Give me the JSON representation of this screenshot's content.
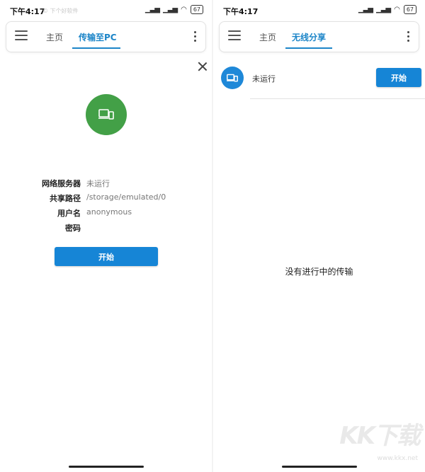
{
  "status_bar": {
    "time": "下午4:17",
    "left_watermark": "© 下个好软件",
    "signal_1": "▁▃▅",
    "signal_2": "▁▃▅",
    "wifi": "◠",
    "battery": "67"
  },
  "left_panel": {
    "tabs": [
      {
        "label": "主页",
        "active": false
      },
      {
        "label": "传输至PC",
        "active": true
      }
    ],
    "info": [
      {
        "label": "网络服务器",
        "value": "未运行"
      },
      {
        "label": "共享路径",
        "value": "/storage/emulated/0"
      },
      {
        "label": "用户名",
        "value": "anonymous"
      },
      {
        "label": "密码",
        "value": ""
      }
    ],
    "start_button": "开始",
    "icon": "devices-icon",
    "icon_color": "#43a047"
  },
  "right_panel": {
    "tabs": [
      {
        "label": "主页",
        "active": false
      },
      {
        "label": "无线分享",
        "active": true
      }
    ],
    "service_status": "未运行",
    "start_button": "开始",
    "empty_message": "没有进行中的传输",
    "icon": "devices-icon",
    "icon_color": "#1e88d8"
  },
  "accent_color": "#1685d6",
  "watermark": {
    "logo": "KK下载",
    "url": "www.kkx.net"
  }
}
